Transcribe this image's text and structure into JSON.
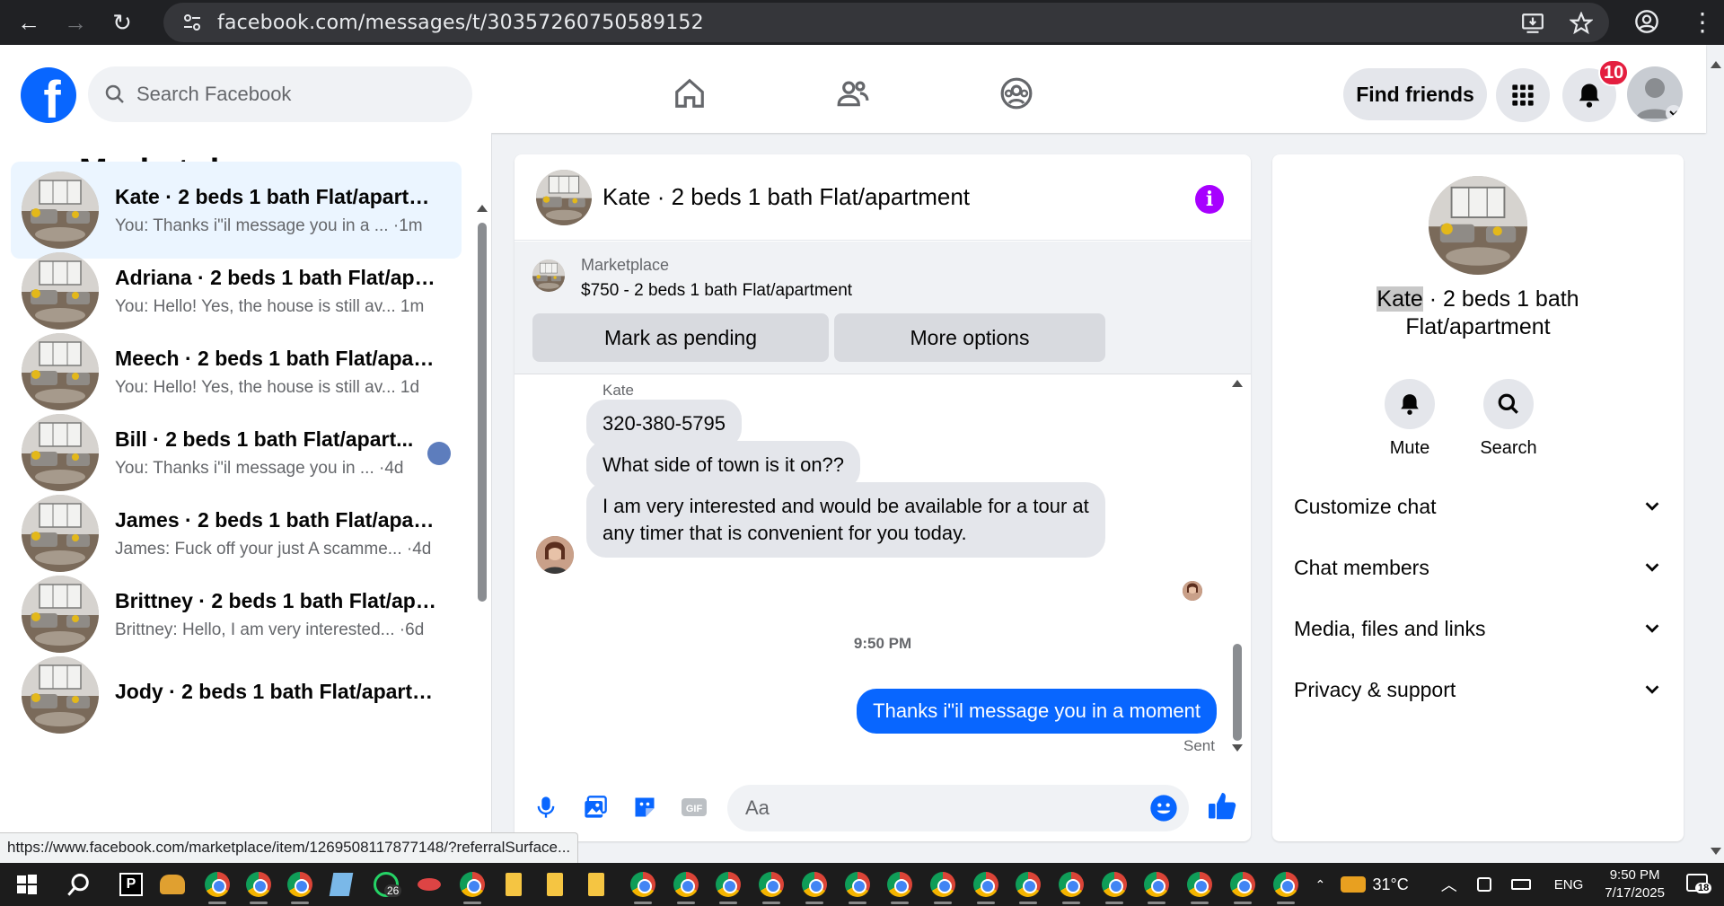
{
  "browser": {
    "url": "facebook.com/messages/t/30357260750589152"
  },
  "header": {
    "search_placeholder": "Search Facebook",
    "find_friends_label": "Find friends",
    "notification_count": "10"
  },
  "sidebar": {
    "title": "Marketplace",
    "conversations": [
      {
        "name": "Kate · 2 beds 1 bath Flat/apartm...",
        "preview": "You: Thanks i\"il message you in a ...",
        "time": "·1m"
      },
      {
        "name": "Adriana · 2 beds 1 bath Flat/apar...",
        "preview": "You: Hello! Yes, the house is still av...",
        "time": "1m"
      },
      {
        "name": "Meech · 2 beds 1 bath Flat/apart...",
        "preview": "You: Hello! Yes, the house is still av...",
        "time": "1d"
      },
      {
        "name": "Bill · 2 beds 1 bath Flat/apart...",
        "preview": "You: Thanks i\"il message you in ...",
        "time": "·4d"
      },
      {
        "name": "James · 2 beds 1 bath Flat/apart...",
        "preview": "James: Fuck off your just A scamme...",
        "time": "·4d"
      },
      {
        "name": "Brittney · 2 beds 1 bath Flat/apa...",
        "preview": "Brittney: Hello, I am very interested...",
        "time": "·6d"
      },
      {
        "name": "Jody · 2 beds 1 bath Flat/apartm...",
        "preview": "",
        "time": ""
      }
    ]
  },
  "chat": {
    "title": "Kate · 2 beds 1 bath Flat/apartment",
    "marketplace_label": "Marketplace",
    "listing": "$750 - 2 beds 1 bath Flat/apartment",
    "mark_pending_label": "Mark as pending",
    "more_options_label": "More options",
    "sender": "Kate",
    "messages_in": [
      "320-380-5795",
      "What side of town is it on??",
      "I am very interested and would be available for a tour at any timer that is convenient for you today."
    ],
    "timestamp": "9:50 PM",
    "message_out": "Thanks i\"il message you in a moment",
    "sent_label": "Sent",
    "input_placeholder": "Aa"
  },
  "info_panel": {
    "name_highlight": "Kate",
    "title_rest": " · 2 beds 1 bath",
    "title_line2": "Flat/apartment",
    "mute_label": "Mute",
    "search_label": "Search",
    "rows": [
      "Customize chat",
      "Chat members",
      "Media, files and links",
      "Privacy & support"
    ]
  },
  "status_url": "https://www.facebook.com/marketplace/item/1269508117877148/?referralSurface...",
  "taskbar": {
    "whatsapp_badge": "26",
    "weather": "31°C",
    "language": "ENG",
    "time": "9:50 PM",
    "date": "7/17/2025",
    "notif_count": "18"
  },
  "colors": {
    "fb_blue": "#0866ff",
    "info_purple": "#a700ff",
    "badge_red": "#e41e3f",
    "active_conv": "#ebf5ff"
  }
}
